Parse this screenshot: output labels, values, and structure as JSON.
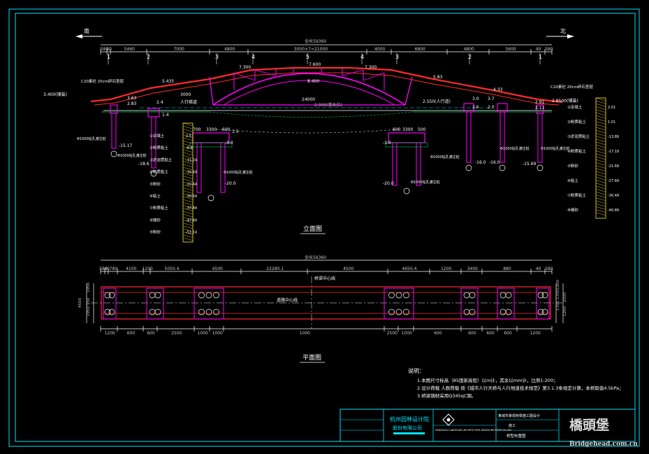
{
  "drawing": {
    "north_label": "北",
    "south_label": "南",
    "elevation_title": "立面图",
    "plan_title": "平面图",
    "top_total_label": "全长59360",
    "top_dims": [
      "580",
      "40",
      "5460",
      "7000",
      "4800",
      "3000×7=21000",
      "4000",
      "6800",
      "4800",
      "5600",
      "40",
      "580"
    ],
    "plan_total_label": "全长56360",
    "plan_top_dims": [
      "580",
      "40",
      "780",
      "4100",
      "1200",
      "5050.4",
      "4500",
      "22280.1",
      "4500",
      "4650.4",
      "1200",
      "3400",
      "880",
      "40",
      "580"
    ],
    "plan_bottom_dims": [
      "1200",
      "600",
      "600",
      "2500",
      "1000",
      "1000",
      "1000",
      "2500",
      "1000",
      "600",
      "600",
      "600",
      "600",
      "1200"
    ],
    "plan_side_dims": [
      "4500",
      "1950",
      "950",
      "1950",
      "1200",
      "1700",
      "1700",
      "2500",
      "1200"
    ],
    "elev_levels": [
      "3.400(铺装)",
      "2.83",
      "3.63",
      "5.435",
      "7.300",
      "7.600",
      "8.400",
      "7.300",
      "5.83",
      "4.33",
      "2.91",
      "2.11",
      "2.8500(铺装)",
      "2.4",
      "1.4",
      "3.0",
      "3.7",
      "2.6",
      "2.0"
    ],
    "elev_dims": [
      "3000",
      "24000",
      "2.000(常水位)",
      "2.550(人行道)",
      "700",
      "3300",
      "600",
      "600",
      "3300",
      "500"
    ],
    "pile_levels": [
      "-15.17",
      "-18.6",
      "-20.0",
      "-20.0",
      "-16.0",
      "-16.0",
      "-15.69",
      "-3.0",
      "-3.0",
      "1.5"
    ],
    "pile_labels": [
      "Φ1000钻孔灌注桩",
      "Φ1000钻孔灌注桩",
      "Φ1000钻孔灌注桩",
      "Φ1000钻孔灌注桩",
      "Φ1000钻孔灌注桩",
      "Φ1000钻孔灌注桩",
      "Φ1000钻孔灌注桩"
    ],
    "axis_numbers": [
      "1",
      "2",
      "3",
      "4",
      "5",
      "4",
      "3",
      "2",
      "1"
    ],
    "walkway_label": "人行梯道",
    "deck_label_left": "C20素砼 20cm碎石垫层",
    "deck_label_right": "C20素砼 20cm碎石垫层",
    "bridge_centerline": "桥梁中心线",
    "road_centerline": "道路中心线",
    "water_level_label": "常水位",
    "soil_layers_left": [
      "①杂填土",
      "②粉质粘土",
      "③淤泥质粘土",
      "④粉质粘土",
      "⑤粉砂",
      "⑥粘土",
      "⑦粉质粘土",
      "⑧细砂",
      "⑨粉砂"
    ],
    "soil_layers_right": [
      "①杂填土",
      "②粉质粘土",
      "③淤泥质粘土",
      "④粉质粘土",
      "⑤粉砂",
      "⑥粘土",
      "⑦粉质粘土",
      "⑧细砂"
    ],
    "soil_depths_left": [
      "2.5",
      "-8.4",
      "-11.24",
      "-16.64",
      "-22.64",
      "-30.54",
      "-37.84",
      "-47.84",
      "-51.14"
    ],
    "soil_depths_right": [
      "2.01",
      "1.01",
      "-13.89",
      "-17.19",
      "-21.69",
      "-27.69",
      "-30.49",
      "-40.89"
    ]
  },
  "notes": {
    "heading": "说明：",
    "items": [
      "1.本图尺寸标高（85国家高程）以m计，其余以mm计，比例1:200；",
      "2.设计荷载 人群荷载 按《城市人行天桥与人行地道技术规范》第3.1.3条规定计算，本桥取值4.5kPa；",
      "3.桥梁钢材采用Q345qC钢。"
    ]
  },
  "title_block": {
    "institute_line1": "杭州园林设计院",
    "institute_line2": "股份有限公司",
    "institute_en": "HANGZHOU LANDSCAPE ARCHITECTURE DESIGN INSTITUTE CO.,LTD",
    "project_name": "某城市景观桥梁施工图设计",
    "sheet_name": "桥型布置图",
    "sheet_tag": "施工"
  },
  "watermark": {
    "logo_text": "橋頭堡",
    "site": "Bridgehead.com.cn"
  },
  "colors": {
    "frame": "#00e5ff",
    "deck": "#ff2a2a",
    "arch": "#ff00ff",
    "pile": "#ff00ff",
    "hatch": "#00c853",
    "text": "#ffffff"
  }
}
